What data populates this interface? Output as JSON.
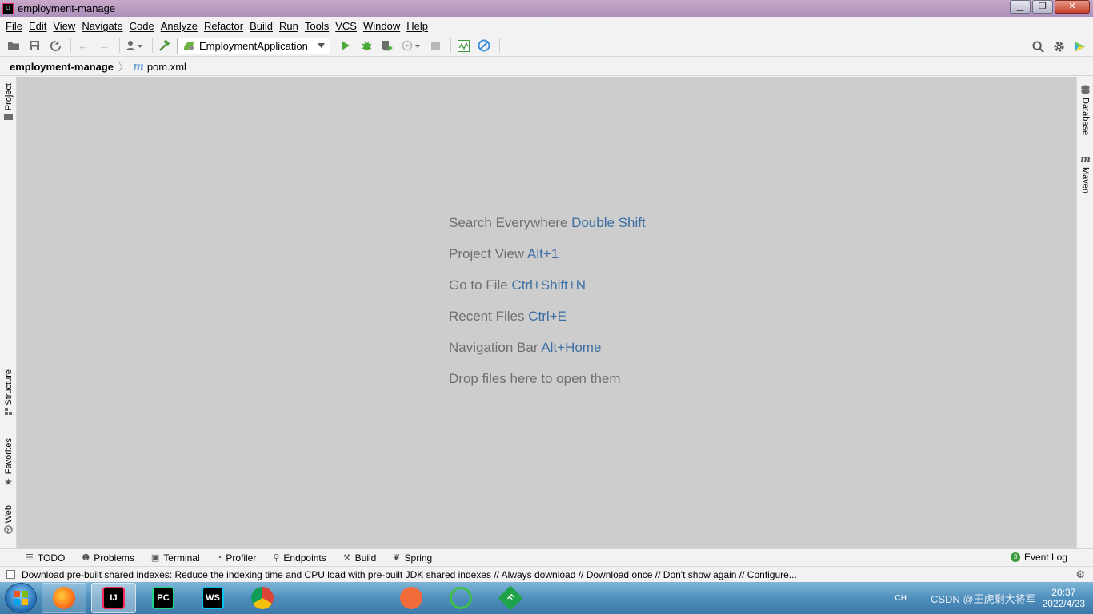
{
  "window": {
    "title": "employment-manage",
    "logo_text": "IJ",
    "minimize": "▁",
    "restore": "❐",
    "close": "✕"
  },
  "menu": [
    "File",
    "Edit",
    "View",
    "Navigate",
    "Code",
    "Analyze",
    "Refactor",
    "Build",
    "Run",
    "Tools",
    "VCS",
    "Window",
    "Help"
  ],
  "toolbar": {
    "run_config": "EmploymentApplication"
  },
  "breadcrumb": {
    "project": "employment-manage",
    "file_icon": "m",
    "file": "pom.xml"
  },
  "left_tabs": {
    "project": "Project",
    "structure": "Structure",
    "favorites": "Favorites",
    "web": "Web"
  },
  "right_tabs": {
    "database": "Database",
    "maven": "Maven"
  },
  "hints": [
    {
      "text": "Search Everywhere",
      "key": "Double Shift"
    },
    {
      "text": "Project View",
      "key": "Alt+1"
    },
    {
      "text": "Go to File",
      "key": "Ctrl+Shift+N"
    },
    {
      "text": "Recent Files",
      "key": "Ctrl+E"
    },
    {
      "text": "Navigation Bar",
      "key": "Alt+Home"
    },
    {
      "text": "Drop files here to open them",
      "key": ""
    }
  ],
  "bottom_tools": [
    "TODO",
    "Problems",
    "Terminal",
    "Profiler",
    "Endpoints",
    "Build",
    "Spring"
  ],
  "event_log": {
    "label": "Event Log",
    "count": "3"
  },
  "status": {
    "message": "Download pre-built shared indexes: Reduce the indexing time and CPU load with pre-built JDK shared indexes // Always download // Download once // Don't show again // Configure..."
  },
  "taskbar": {
    "apps": [
      {
        "name": "firefox",
        "label": ""
      },
      {
        "name": "intellij",
        "label": "IJ"
      },
      {
        "name": "pycharm",
        "label": "PC"
      },
      {
        "name": "webstorm",
        "label": "WS"
      },
      {
        "name": "chrome",
        "label": ""
      },
      {
        "name": "git",
        "label": ""
      },
      {
        "name": "dolphin",
        "label": ""
      },
      {
        "name": "postman",
        "label": ""
      },
      {
        "name": "navicat",
        "label": ""
      },
      {
        "name": "fdm",
        "label": "F"
      }
    ],
    "lang": "CH",
    "watermark": "CSDN @王虎剩大将军",
    "time": "20:37",
    "date": "2022/4/23"
  },
  "colors": {
    "accent": "#3c6ea3",
    "editor_bg": "#cdcdcd",
    "hint_text": "#6f6f6f"
  }
}
